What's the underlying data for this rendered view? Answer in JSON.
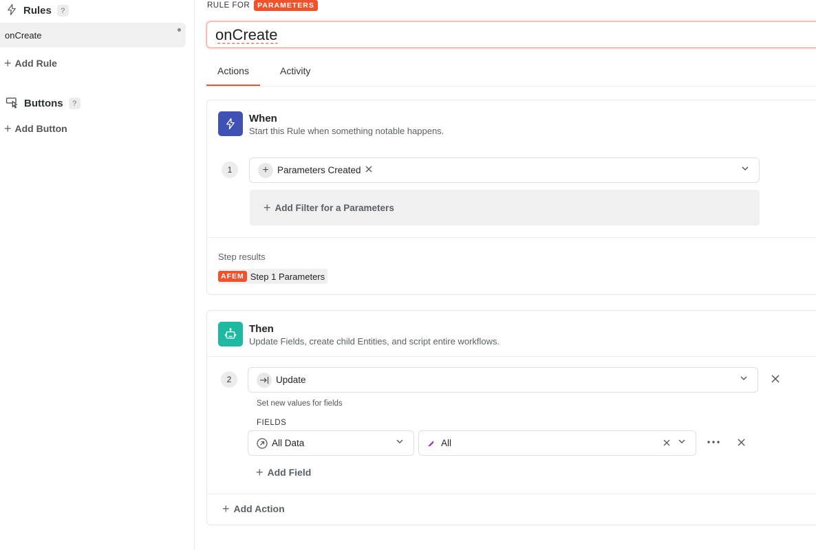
{
  "sidebar": {
    "rules_title": "Rules",
    "help_mark": "?",
    "rule_items": [
      {
        "label": "onCreate"
      }
    ],
    "add_rule_label": "Add Rule",
    "buttons_title": "Buttons",
    "add_button_label": "Add Button"
  },
  "header": {
    "rule_for_label": "RULE FOR",
    "entity_badge": "PARAMETERS",
    "rule_name_value": "onCreate"
  },
  "tabs": [
    {
      "label": "Actions",
      "active": true
    },
    {
      "label": "Activity",
      "active": false
    }
  ],
  "when_card": {
    "title": "When",
    "subtitle": "Start this Rule when something notable happens.",
    "step_number": "1",
    "trigger_value": "Parameters Created",
    "add_filter_label": "Add Filter for a Parameters",
    "step_results_label": "Step results",
    "result_tag": "AFEM",
    "result_label": "Step 1 Parameters"
  },
  "then_card": {
    "title": "Then",
    "subtitle": "Update Fields, create child Entities, and script entire workflows.",
    "step_number": "2",
    "action_value": "Update",
    "action_hint": "Set new values for fields",
    "fields_label": "FIELDS",
    "field_source_value": "All Data",
    "field_value": "All",
    "add_field_label": "Add Field",
    "add_action_label": "Add Action"
  },
  "colors": {
    "accent": "#f0522b",
    "when_icon_bg": "#3f51b5",
    "then_icon_bg": "#1db9a0",
    "field_marker": "#9c27b0"
  }
}
